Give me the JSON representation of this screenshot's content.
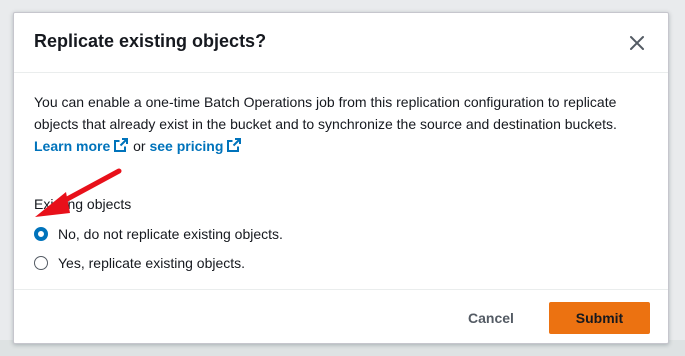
{
  "modal": {
    "title": "Replicate existing objects?",
    "close_label": "Close"
  },
  "body": {
    "description": "You can enable a one-time Batch Operations job from this replication configuration to replicate objects that already exist in the bucket and to synchronize the source and destination buckets.",
    "learn_more_link": "Learn more",
    "connector": "or",
    "see_pricing_link": "see pricing",
    "link_icon": "external-link-icon"
  },
  "field": {
    "label": "Existing objects",
    "options": [
      {
        "label": "No, do not replicate existing objects.",
        "selected": true
      },
      {
        "label": "Yes, replicate existing objects.",
        "selected": false
      }
    ]
  },
  "footer": {
    "cancel_label": "Cancel",
    "submit_label": "Submit"
  },
  "colors": {
    "link": "#0073bb",
    "radio_selected": "#0073bb",
    "primary_button": "#ec7211",
    "annotation_arrow": "#e8101a"
  }
}
